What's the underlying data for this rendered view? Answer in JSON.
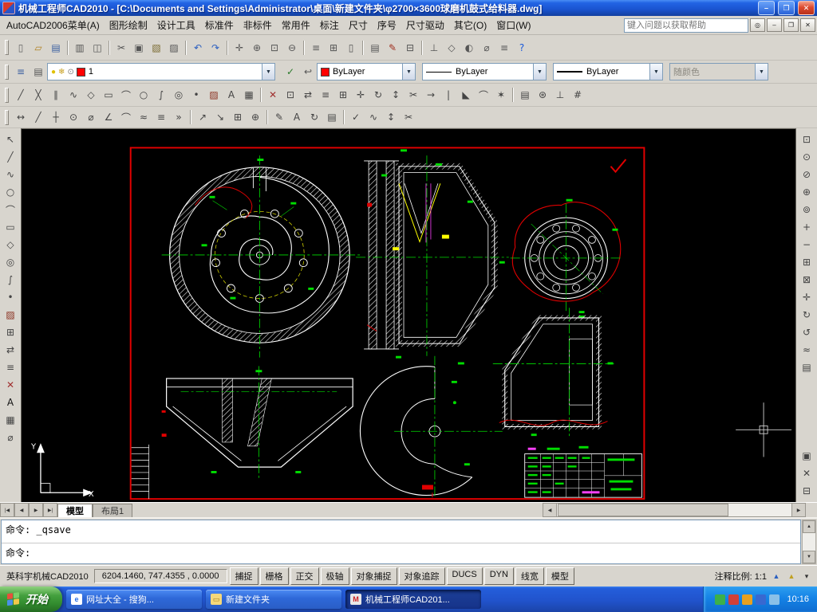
{
  "window": {
    "title": "机械工程师CAD2010 - [C:\\Documents and Settings\\Administrator\\桌面\\新建文件夹\\φ2700×3600球磨机鼓式给料器.dwg]",
    "controls": {
      "minimize": "–",
      "maximize": "❐",
      "close": "✕"
    }
  },
  "menu": {
    "items": [
      "AutoCAD2006菜单(A)",
      "图形绘制",
      "设计工具",
      "标准件",
      "非标件",
      "常用件",
      "标注",
      "尺寸",
      "序号",
      "尺寸驱动",
      "其它(O)",
      "窗口(W)"
    ],
    "help_placeholder": "键入问题以获取帮助",
    "search_glyph": "◎",
    "mdi_controls": {
      "minimize": "–",
      "restore": "❐",
      "close": "✕"
    }
  },
  "toolbars": {
    "standard": [
      {
        "n": "new-button",
        "g": "▯",
        "c": "#666666"
      },
      {
        "n": "open-button",
        "g": "▱",
        "c": "#b08020"
      },
      {
        "n": "save-button",
        "g": "▤",
        "c": "#3a5fa0"
      },
      {
        "sep": true
      },
      {
        "n": "plot-button",
        "g": "▥",
        "c": "#555555"
      },
      {
        "n": "plot-preview-button",
        "g": "◫",
        "c": "#555555"
      },
      {
        "sep": true
      },
      {
        "n": "cut-button",
        "g": "✂",
        "c": "#555555"
      },
      {
        "n": "copy-button",
        "g": "▣",
        "c": "#555555"
      },
      {
        "n": "paste-button",
        "g": "▧",
        "c": "#7a6a30"
      },
      {
        "n": "match-properties-button",
        "g": "▨",
        "c": "#555555"
      },
      {
        "sep": true
      },
      {
        "n": "undo-button",
        "g": "↶",
        "c": "#2b5fc0"
      },
      {
        "n": "redo-button",
        "g": "↷",
        "c": "#2b5fc0"
      },
      {
        "sep": true
      },
      {
        "n": "pan-button",
        "g": "✛",
        "c": "#555555"
      },
      {
        "n": "zoom-realtime-button",
        "g": "⊕",
        "c": "#555555"
      },
      {
        "n": "zoom-window-button",
        "g": "⊡",
        "c": "#555555"
      },
      {
        "n": "zoom-previous-button",
        "g": "⊖",
        "c": "#555555"
      },
      {
        "sep": true
      },
      {
        "n": "properties-button",
        "g": "≡",
        "c": "#555555"
      },
      {
        "n": "design-center-button",
        "g": "⊞",
        "c": "#555555"
      },
      {
        "n": "tool-palettes-button",
        "g": "▯",
        "c": "#555555"
      },
      {
        "sep": true
      },
      {
        "n": "sheet-set-button",
        "g": "▤",
        "c": "#555555"
      },
      {
        "n": "markup-button",
        "g": "✎",
        "c": "#a03020"
      },
      {
        "n": "qcalc-button",
        "g": "⊟",
        "c": "#555555"
      },
      {
        "sep": true
      },
      {
        "n": "ucs-button",
        "g": "⊥",
        "c": "#555555"
      },
      {
        "n": "named-views-button",
        "g": "◇",
        "c": "#555555"
      },
      {
        "n": "render-button",
        "g": "◐",
        "c": "#555555"
      },
      {
        "n": "measure-button",
        "g": "⌀",
        "c": "#555555"
      },
      {
        "n": "list-button",
        "g": "≡",
        "c": "#555555"
      },
      {
        "n": "help-button",
        "g": "?",
        "c": "#1a5adb"
      }
    ],
    "properties": {
      "left_icons": [
        {
          "n": "layer-manager-button",
          "g": "≡",
          "c": "#3a5fa0"
        },
        {
          "n": "layer-states-button",
          "g": "▤",
          "c": "#555555"
        }
      ],
      "layer": {
        "value": "1",
        "swatch": "#ff0000",
        "bulb": "●",
        "freeze": "❄",
        "lock": "⊙"
      },
      "mid_icons": [
        {
          "n": "make-object-layer-current-button",
          "g": "✓",
          "c": "#2a7a2a"
        },
        {
          "n": "layer-previous-button",
          "g": "↩",
          "c": "#555555"
        }
      ],
      "color": {
        "value": "ByLayer",
        "swatch": "#ff0000"
      },
      "linetype": {
        "value": "ByLayer"
      },
      "lineweight": {
        "value": "ByLayer"
      },
      "plotstyle": {
        "value": "随颜色"
      }
    },
    "draw_modify": [
      {
        "n": "line-button",
        "g": "╱",
        "c": "#444444"
      },
      {
        "n": "xline-button",
        "g": "╳",
        "c": "#444444"
      },
      {
        "n": "mline-button",
        "g": "∥",
        "c": "#444444"
      },
      {
        "n": "polyline-button",
        "g": "∿",
        "c": "#444444"
      },
      {
        "n": "polygon-button",
        "g": "◇",
        "c": "#444444"
      },
      {
        "n": "rectangle-button",
        "g": "▭",
        "c": "#444444"
      },
      {
        "n": "arc-button",
        "g": "⌒",
        "c": "#444444"
      },
      {
        "n": "circle-button",
        "g": "○",
        "c": "#444444"
      },
      {
        "n": "spline-button",
        "g": "∫",
        "c": "#444444"
      },
      {
        "n": "ellipse-button",
        "g": "◎",
        "c": "#444444"
      },
      {
        "n": "point-button",
        "g": "•",
        "c": "#444444"
      },
      {
        "n": "hatch-button",
        "g": "▨",
        "c": "#8a3020"
      },
      {
        "n": "text-button",
        "g": "A",
        "c": "#444444"
      },
      {
        "n": "table-button",
        "g": "▦",
        "c": "#444444"
      },
      {
        "sep": true
      },
      {
        "n": "erase-button",
        "g": "✕",
        "c": "#a03030"
      },
      {
        "n": "copy-object-button",
        "g": "⊡",
        "c": "#444444"
      },
      {
        "n": "mirror-button",
        "g": "⇄",
        "c": "#444444"
      },
      {
        "n": "offset-button",
        "g": "≡",
        "c": "#444444"
      },
      {
        "n": "array-button",
        "g": "⊞",
        "c": "#444444"
      },
      {
        "n": "move-button",
        "g": "✛",
        "c": "#444444"
      },
      {
        "n": "rotate-button",
        "g": "↻",
        "c": "#444444"
      },
      {
        "n": "scale-button",
        "g": "↕",
        "c": "#444444"
      },
      {
        "n": "trim-button",
        "g": "✂",
        "c": "#444444"
      },
      {
        "n": "extend-button",
        "g": "→",
        "c": "#444444"
      },
      {
        "n": "break-button",
        "g": "|",
        "c": "#444444"
      },
      {
        "n": "chamfer-button",
        "g": "◣",
        "c": "#444444"
      },
      {
        "n": "fillet-button",
        "g": "⌒",
        "c": "#444444"
      },
      {
        "n": "explode-button",
        "g": "✶",
        "c": "#444444"
      },
      {
        "sep": true
      },
      {
        "n": "dimstyle-button",
        "g": "▤",
        "c": "#444444"
      },
      {
        "n": "osnap-settings-button",
        "g": "⊛",
        "c": "#444444"
      },
      {
        "n": "ortho-settings-button",
        "g": "⊥",
        "c": "#444444"
      },
      {
        "n": "grid-settings-button",
        "g": "#",
        "c": "#444444"
      }
    ],
    "dimension": [
      {
        "n": "dim-linear-button",
        "g": "↔",
        "c": "#444444"
      },
      {
        "n": "dim-aligned-button",
        "g": "╱",
        "c": "#444444"
      },
      {
        "n": "dim-ordinate-button",
        "g": "┼",
        "c": "#444444"
      },
      {
        "n": "dim-radius-button",
        "g": "⊙",
        "c": "#444444"
      },
      {
        "n": "dim-diameter-button",
        "g": "⌀",
        "c": "#444444"
      },
      {
        "n": "dim-angular-button",
        "g": "∠",
        "c": "#444444"
      },
      {
        "n": "dim-arc-button",
        "g": "⌒",
        "c": "#444444"
      },
      {
        "n": "qdim-button",
        "g": "≈",
        "c": "#444444"
      },
      {
        "n": "dim-baseline-button",
        "g": "≡",
        "c": "#444444"
      },
      {
        "n": "dim-continue-button",
        "g": "»",
        "c": "#444444"
      },
      {
        "sep": true
      },
      {
        "n": "leader-button",
        "g": "↗",
        "c": "#444444"
      },
      {
        "n": "mleader-button",
        "g": "↘",
        "c": "#444444"
      },
      {
        "n": "tolerance-button",
        "g": "⊞",
        "c": "#444444"
      },
      {
        "n": "center-mark-button",
        "g": "⊕",
        "c": "#444444"
      },
      {
        "sep": true
      },
      {
        "n": "dim-edit-button",
        "g": "✎",
        "c": "#444444"
      },
      {
        "n": "dim-text-edit-button",
        "g": "A",
        "c": "#444444"
      },
      {
        "n": "dim-update-button",
        "g": "↻",
        "c": "#444444"
      },
      {
        "n": "dim-style-button",
        "g": "▤",
        "c": "#444444"
      },
      {
        "sep": true
      },
      {
        "n": "dim-inspect-button",
        "g": "✓",
        "c": "#444444"
      },
      {
        "n": "dim-jog-button",
        "g": "∿",
        "c": "#444444"
      },
      {
        "n": "dim-space-button",
        "g": "↕",
        "c": "#444444"
      },
      {
        "n": "dim-break-button",
        "g": "✂",
        "c": "#444444"
      }
    ],
    "left": [
      {
        "n": "select-button",
        "g": "↖",
        "c": "#444444"
      },
      {
        "n": "line-button",
        "g": "╱",
        "c": "#444444"
      },
      {
        "n": "polyline-button",
        "g": "∿",
        "c": "#444444"
      },
      {
        "n": "circle-button",
        "g": "○",
        "c": "#444444"
      },
      {
        "n": "arc-button",
        "g": "⌒",
        "c": "#444444"
      },
      {
        "n": "rectangle-button",
        "g": "▭",
        "c": "#444444"
      },
      {
        "n": "polygon-button",
        "g": "◇",
        "c": "#444444"
      },
      {
        "n": "ellipse-button",
        "g": "◎",
        "c": "#444444"
      },
      {
        "n": "spline-button",
        "g": "∫",
        "c": "#444444"
      },
      {
        "n": "point-button",
        "g": "•",
        "c": "#444444"
      },
      {
        "n": "hatch-button",
        "g": "▨",
        "c": "#8a3020"
      },
      {
        "n": "block-button",
        "g": "⊞",
        "c": "#444444"
      },
      {
        "n": "mirror-button",
        "g": "⇄",
        "c": "#444444"
      },
      {
        "n": "offset-button",
        "g": "≡",
        "c": "#444444"
      },
      {
        "n": "erase-button",
        "g": "✕",
        "c": "#a03030"
      },
      {
        "n": "text-button",
        "g": "A",
        "c": "#111111"
      },
      {
        "n": "table-button",
        "g": "▦",
        "c": "#444444"
      },
      {
        "n": "measure-button",
        "g": "⌀",
        "c": "#444444"
      }
    ],
    "right": [
      {
        "n": "zoom-window-button",
        "g": "⊡",
        "c": "#444444"
      },
      {
        "n": "zoom-dynamic-button",
        "g": "⊙",
        "c": "#444444"
      },
      {
        "n": "zoom-scale-button",
        "g": "⊘",
        "c": "#444444"
      },
      {
        "n": "zoom-center-button",
        "g": "⊕",
        "c": "#444444"
      },
      {
        "n": "zoom-object-button",
        "g": "⊚",
        "c": "#444444"
      },
      {
        "n": "zoom-in-button",
        "g": "+",
        "c": "#444444"
      },
      {
        "n": "zoom-out-button",
        "g": "−",
        "c": "#444444"
      },
      {
        "n": "zoom-all-button",
        "g": "⊞",
        "c": "#444444"
      },
      {
        "n": "zoom-extents-button",
        "g": "⊠",
        "c": "#444444"
      },
      {
        "n": "pan-button",
        "g": "✛",
        "c": "#444444"
      },
      {
        "n": "orbit-button",
        "g": "↻",
        "c": "#444444"
      },
      {
        "n": "redraw-button",
        "g": "↺",
        "c": "#444444"
      },
      {
        "n": "regen-button",
        "g": "≈",
        "c": "#444444"
      },
      {
        "n": "named-view-button",
        "g": "▤",
        "c": "#444444"
      }
    ],
    "right_bottom": [
      {
        "n": "draw-order-button",
        "g": "▣",
        "c": "#444444"
      },
      {
        "n": "clean-screen-button",
        "g": "✕",
        "c": "#444444"
      },
      {
        "n": "calculator-button",
        "g": "⊟",
        "c": "#444444"
      }
    ]
  },
  "drawing": {
    "ucs": {
      "x": "X",
      "y": "Y"
    }
  },
  "tabs": {
    "nav": [
      "|◀",
      "◀",
      "▶",
      "▶|"
    ],
    "items": [
      {
        "label": "模型",
        "active": true
      },
      {
        "label": "布局1",
        "active": false
      }
    ],
    "hscroll": {
      "left": "◀",
      "right": "▶"
    }
  },
  "command": {
    "lines": [
      "命令: _qsave",
      "命令:"
    ],
    "scroll": {
      "up": "▲",
      "down": "▼"
    }
  },
  "status": {
    "brand": "英科宇机械CAD2010",
    "coords": "6204.1460, 747.4355 , 0.0000",
    "toggles": [
      "捕捉",
      "栅格",
      "正交",
      "极轴",
      "对象捕捉",
      "对象追踪",
      "DUCS",
      "DYN",
      "线宽",
      "模型"
    ],
    "scale_label": "注释比例: 1:1",
    "icons": [
      {
        "n": "annotation-visibility-icon",
        "g": "▲",
        "c": "#2a5fc0"
      },
      {
        "n": "annotation-autoscale-icon",
        "g": "▲",
        "c": "#c0a020"
      },
      {
        "n": "status-menu-arrow-icon",
        "g": "▾",
        "c": "#333333"
      }
    ]
  },
  "taskbar": {
    "start": "开始",
    "flag_colors": [
      "#e8503c",
      "#7ad06a",
      "#4a90e8",
      "#f2c84b"
    ],
    "tasks": [
      {
        "label": "网址大全 - 搜狗...",
        "icon_bg": "#ffffff",
        "icon_glyph": "e",
        "icon_color": "#2a6fe8",
        "active": false
      },
      {
        "label": "新建文件夹",
        "icon_bg": "#f5d87a",
        "icon_glyph": "▭",
        "icon_color": "#a07818",
        "active": false
      },
      {
        "label": "机械工程师CAD201...",
        "icon_bg": "#e8e8e8",
        "icon_glyph": "M",
        "icon_color": "#cc2222",
        "active": true
      }
    ],
    "tray_icons": [
      {
        "n": "input-method-icon",
        "bg": "#3cb04a"
      },
      {
        "n": "security-icon",
        "bg": "#d04038"
      },
      {
        "n": "sogou-icon",
        "bg": "#e8a020"
      },
      {
        "n": "volume-icon",
        "bg": "#3868d0"
      },
      {
        "n": "network-icon",
        "bg": "#8ac0e8"
      }
    ],
    "time": "10:16"
  }
}
